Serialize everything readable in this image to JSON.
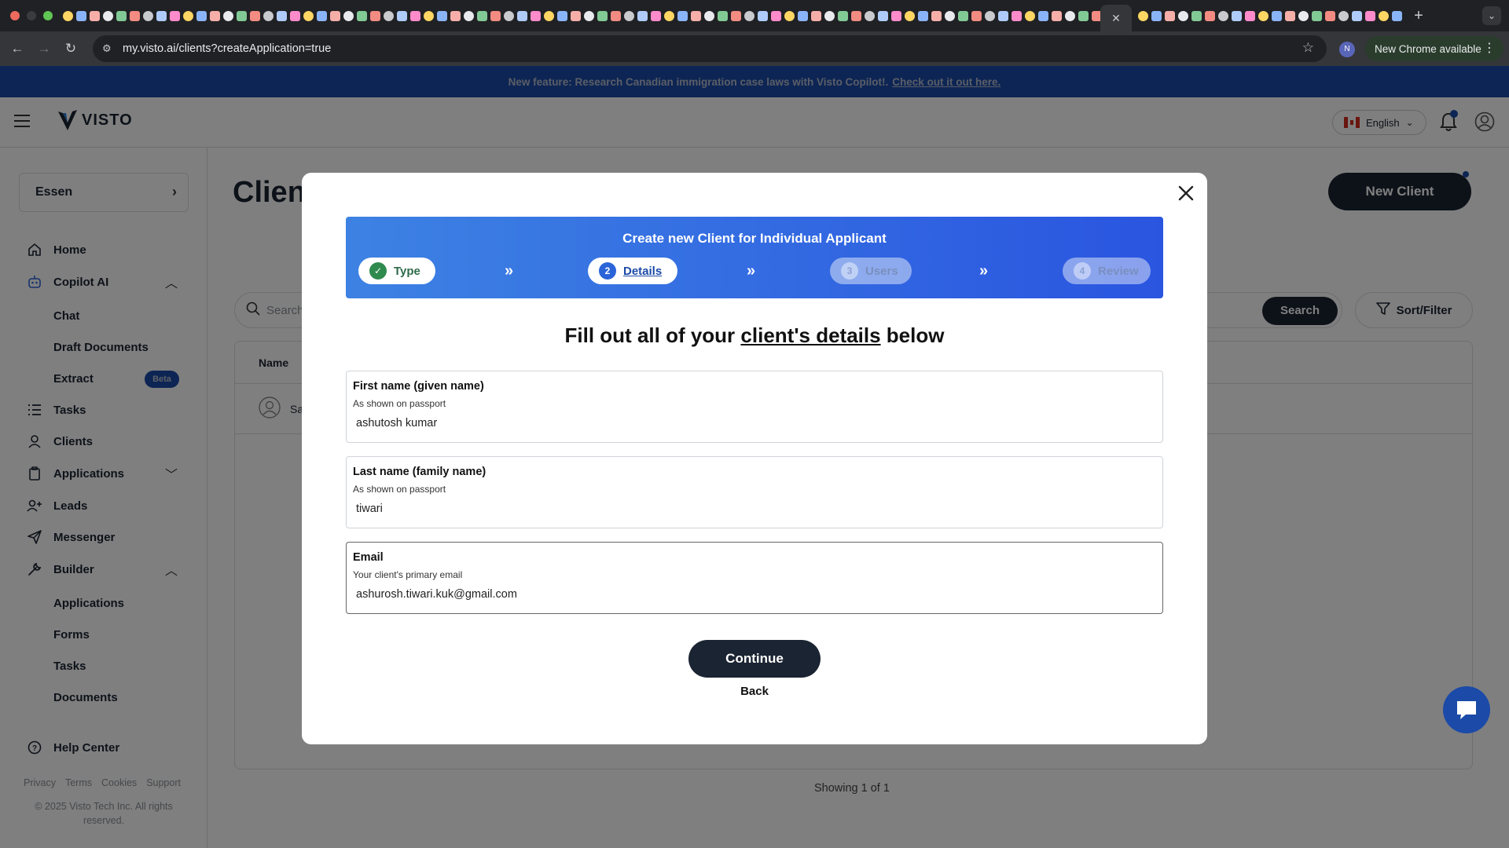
{
  "browser": {
    "url": "my.visto.ai/clients?createApplication=true",
    "update_label": "New Chrome available"
  },
  "banner": {
    "text": "New feature: Research Canadian immigration case laws with Visto Copilot!.",
    "link": "Check out it out here."
  },
  "header": {
    "logo_text": "VISTO",
    "language": "English"
  },
  "sidebar": {
    "org": "Essen",
    "items": [
      {
        "label": "Home"
      },
      {
        "label": "Copilot AI"
      },
      {
        "label": "Chat"
      },
      {
        "label": "Draft Documents"
      },
      {
        "label": "Extract"
      },
      {
        "label": "Tasks"
      },
      {
        "label": "Clients"
      },
      {
        "label": "Applications"
      },
      {
        "label": "Leads"
      },
      {
        "label": "Messenger"
      },
      {
        "label": "Builder"
      },
      {
        "label": "Applications"
      },
      {
        "label": "Forms"
      },
      {
        "label": "Tasks"
      },
      {
        "label": "Documents"
      },
      {
        "label": "Help Center"
      }
    ],
    "beta_badge": "Beta",
    "footer_links": [
      "Privacy",
      "Terms",
      "Cookies",
      "Support"
    ],
    "copyright": "© 2025 Visto Tech Inc. All rights reserved."
  },
  "main": {
    "title": "Clients",
    "new_client": "New Client",
    "search_placeholder": "Search",
    "search_button": "Search",
    "sort_filter": "Sort/Filter",
    "table_header_name": "Name",
    "row_name": "Sa",
    "showing": "Showing 1 of 1"
  },
  "modal": {
    "title": "Create new Client for Individual Applicant",
    "steps": [
      {
        "num": "✓",
        "label": "Type",
        "state": "done"
      },
      {
        "num": "2",
        "label": "Details",
        "state": "current"
      },
      {
        "num": "3",
        "label": "Users",
        "state": "pending"
      },
      {
        "num": "4",
        "label": "Review",
        "state": "pending"
      }
    ],
    "heading_pre": "Fill out all of your",
    "heading_link": "client's details",
    "heading_post": "below",
    "fields": [
      {
        "label": "First name (given name)",
        "hint": "As shown on passport",
        "value": "ashutosh kumar"
      },
      {
        "label": "Last name (family name)",
        "hint": "As shown on passport",
        "value": "tiwari"
      },
      {
        "label": "Email",
        "hint": "Your client's primary email",
        "value": "ashurosh.tiwari.kuk@gmail.com"
      }
    ],
    "continue": "Continue",
    "back": "Back"
  },
  "colors": {
    "brand_navy": "#1b2432",
    "brand_blue": "#1b4aa8",
    "stepper_start": "#3d82e3",
    "stepper_end": "#2a55e0"
  }
}
